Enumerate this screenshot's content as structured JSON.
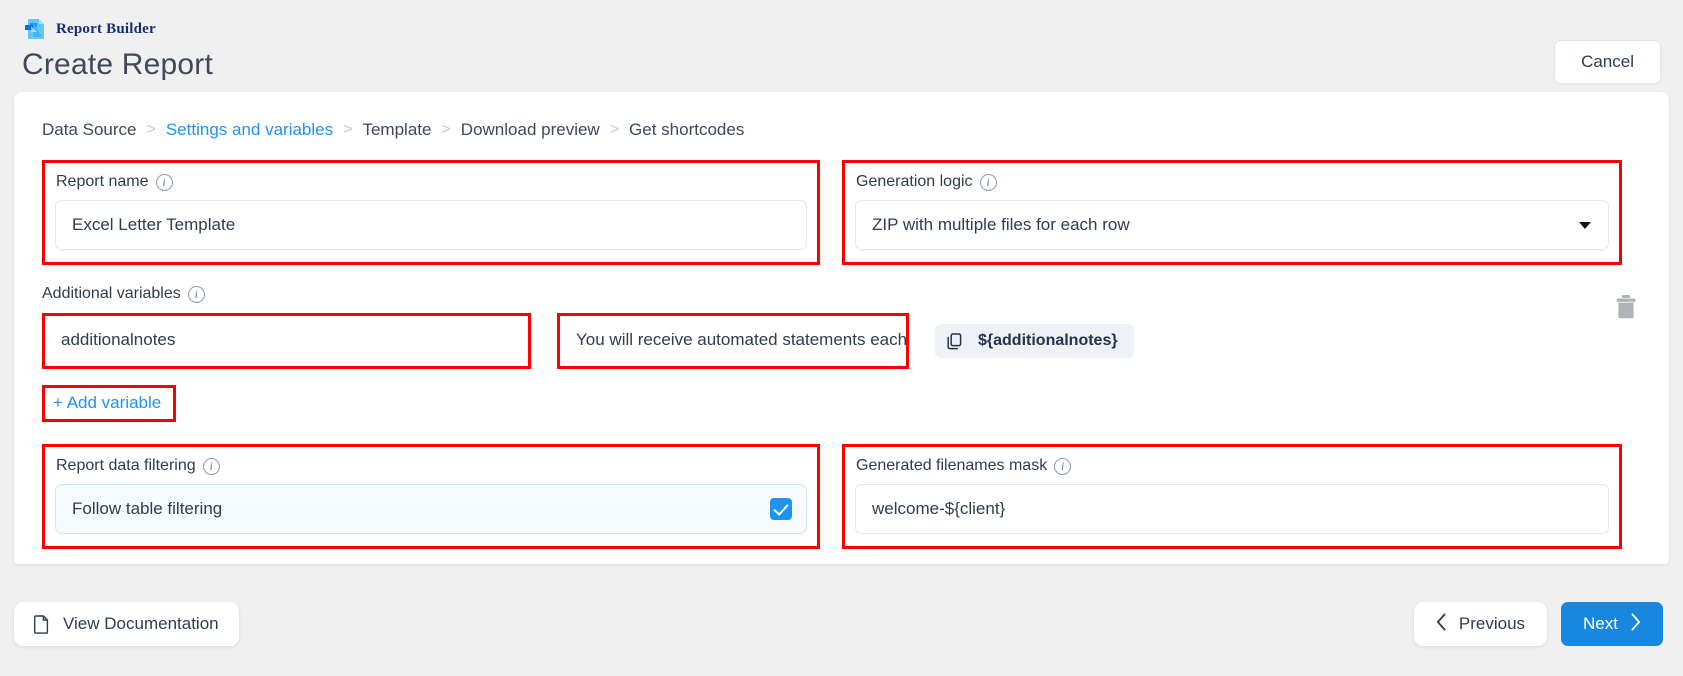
{
  "header": {
    "brand_name": "Report Builder",
    "brand_logo_icon": "report-document-arrow-logo",
    "page_title": "Create Report",
    "cancel_label": "Cancel"
  },
  "breadcrumb": {
    "separator": ">",
    "steps": [
      {
        "label": "Data Source",
        "active": false
      },
      {
        "label": "Settings and variables",
        "active": true
      },
      {
        "label": "Template",
        "active": false
      },
      {
        "label": "Download preview",
        "active": false
      },
      {
        "label": "Get shortcodes",
        "active": false
      }
    ]
  },
  "form": {
    "info_glyph": "i",
    "report_name": {
      "label": "Report name",
      "value": "Excel Letter Template",
      "placeholder": "Report name"
    },
    "generation_logic": {
      "label": "Generation logic",
      "value": "ZIP with multiple files for each row",
      "caret_icon": "chevron-down-icon"
    },
    "additional_variables": {
      "label": "Additional variables",
      "rows": [
        {
          "name": "additionalnotes",
          "name_placeholder": "Variable name",
          "value": "You will receive automated statements each",
          "value_placeholder": "Variable value",
          "shortcode": "${additionalnotes}",
          "copy_icon": "copy-icon",
          "delete_icon": "trash-icon"
        }
      ],
      "add_button_label": "+ Add variable"
    },
    "report_data_filtering": {
      "label": "Report data filtering",
      "option_label": "Follow table filtering",
      "checked": true,
      "checkbox_icon": "checkbox-checked-icon"
    },
    "generated_filenames_mask": {
      "label": "Generated filenames mask",
      "value": "welcome-${client}",
      "placeholder": "Filename mask"
    }
  },
  "footer": {
    "documentation_label": "View Documentation",
    "documentation_icon": "document-icon",
    "previous_label": "Previous",
    "previous_icon": "chevron-left-icon",
    "next_label": "Next",
    "next_icon": "chevron-right-icon"
  },
  "colors": {
    "accent": "#1f93f0",
    "primary_button": "#1787e0",
    "highlight_outline": "#fb0000",
    "page_background": "#f0f0f0",
    "brand_text": "#1a2e6e"
  }
}
